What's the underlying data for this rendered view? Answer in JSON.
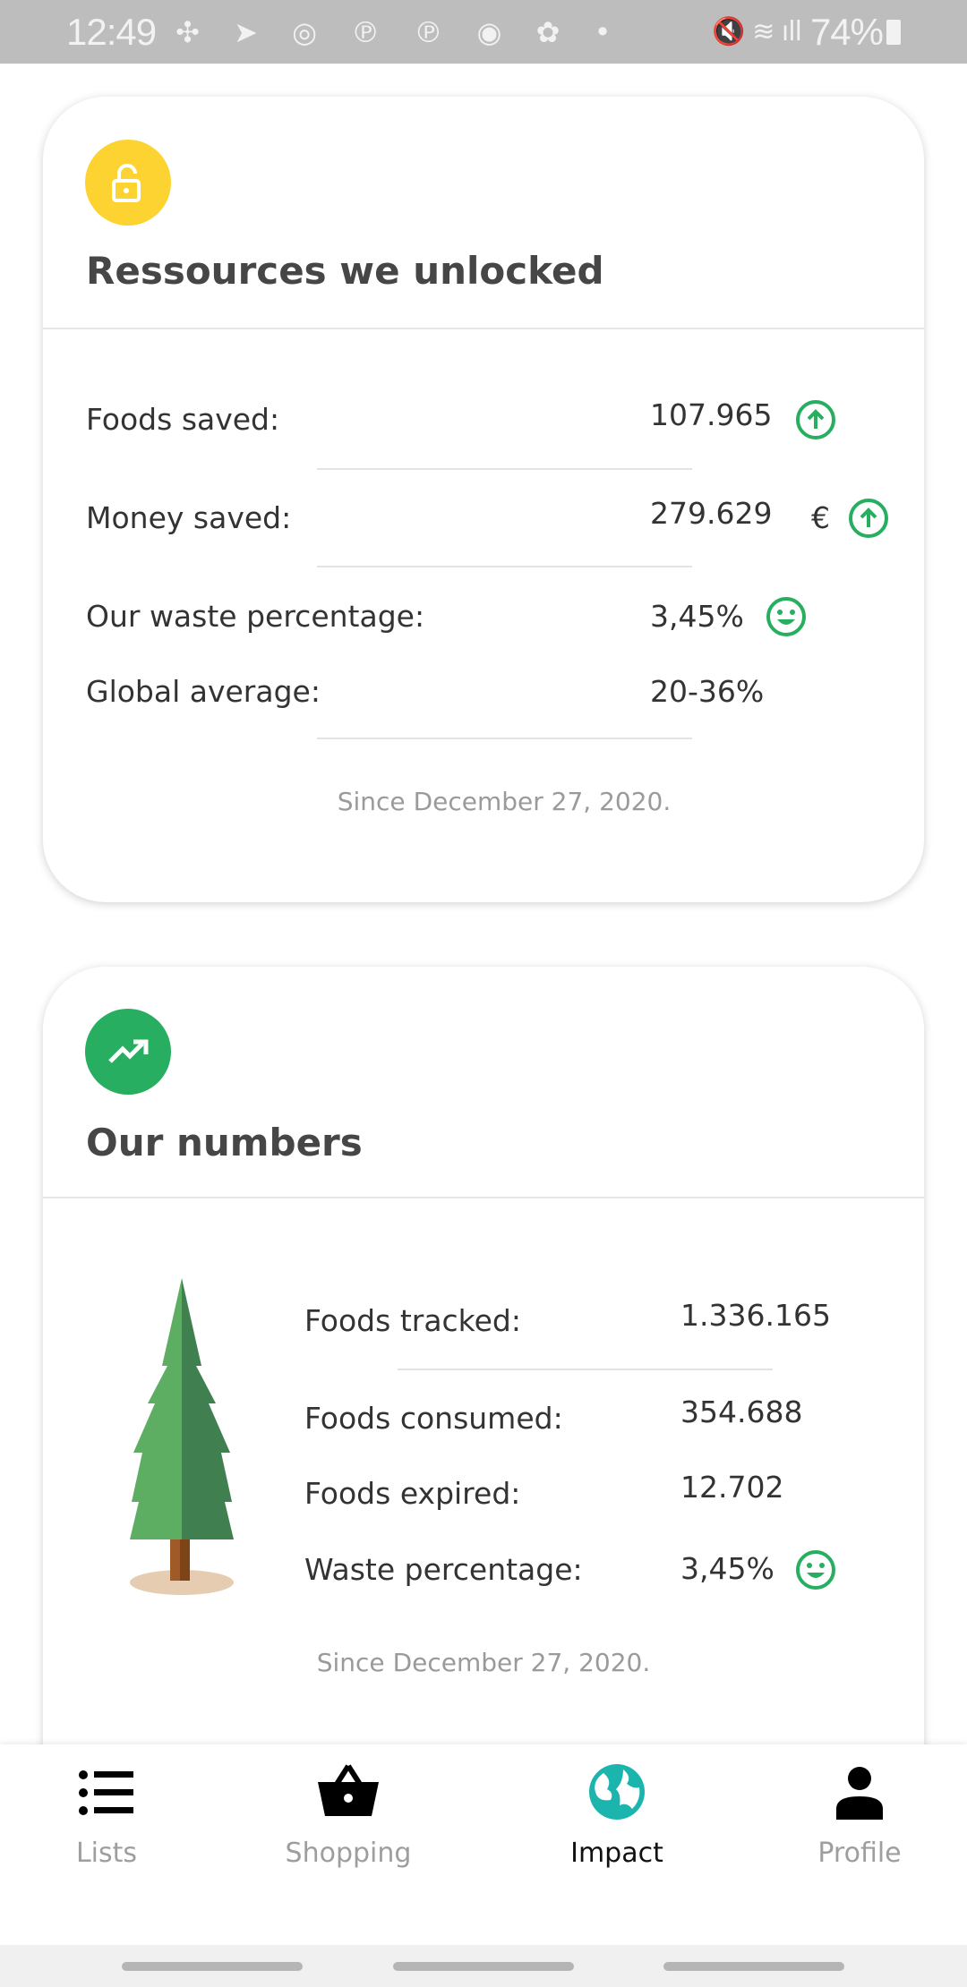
{
  "status_bar": {
    "time": "12:49",
    "battery": "74%"
  },
  "resources_card": {
    "icon": "unlock-icon",
    "icon_color": "#FDD331",
    "title": "Ressources we unlocked",
    "rows": [
      {
        "label": "Foods saved:",
        "value": "107.965",
        "indicator": "arrow-up-circle-icon"
      },
      {
        "label": "Money saved:",
        "value": "279.629",
        "unit": "€",
        "indicator": "arrow-up-circle-icon"
      },
      {
        "label": "Our waste percentage:",
        "value": "3,45%",
        "indicator": "smiley-icon"
      },
      {
        "label": "Global average:",
        "value": "20-36%"
      }
    ],
    "since": "Since December 27, 2020."
  },
  "numbers_card": {
    "icon": "trending-up-icon",
    "icon_color": "#27AE60",
    "title": "Our numbers",
    "rows": [
      {
        "label": "Foods tracked:",
        "value": "1.336.165"
      },
      {
        "label": "Foods consumed:",
        "value": "354.688"
      },
      {
        "label": "Foods expired:",
        "value": "12.702"
      },
      {
        "label": "Waste percentage:",
        "value": "3,45%",
        "indicator": "smiley-icon"
      }
    ],
    "since": "Since December 27, 2020."
  },
  "accent_green": "#27AE60",
  "nav": {
    "active": "Impact",
    "active_color": "#1BB5AE",
    "items": [
      {
        "label": "Lists",
        "icon": "list-icon"
      },
      {
        "label": "Shopping",
        "icon": "basket-icon"
      },
      {
        "label": "Impact",
        "icon": "globe-icon"
      },
      {
        "label": "Profile",
        "icon": "person-icon"
      }
    ]
  }
}
